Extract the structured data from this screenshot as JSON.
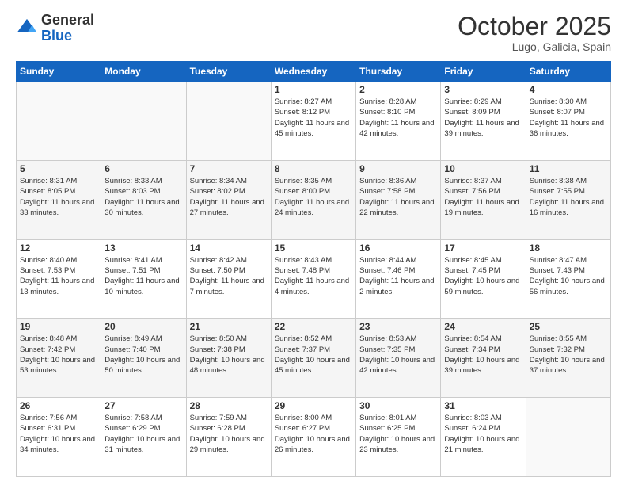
{
  "header": {
    "logo_general": "General",
    "logo_blue": "Blue",
    "month_title": "October 2025",
    "location": "Lugo, Galicia, Spain"
  },
  "calendar": {
    "days_of_week": [
      "Sunday",
      "Monday",
      "Tuesday",
      "Wednesday",
      "Thursday",
      "Friday",
      "Saturday"
    ],
    "weeks": [
      [
        {
          "day": "",
          "info": ""
        },
        {
          "day": "",
          "info": ""
        },
        {
          "day": "",
          "info": ""
        },
        {
          "day": "1",
          "info": "Sunrise: 8:27 AM\nSunset: 8:12 PM\nDaylight: 11 hours and 45 minutes."
        },
        {
          "day": "2",
          "info": "Sunrise: 8:28 AM\nSunset: 8:10 PM\nDaylight: 11 hours and 42 minutes."
        },
        {
          "day": "3",
          "info": "Sunrise: 8:29 AM\nSunset: 8:09 PM\nDaylight: 11 hours and 39 minutes."
        },
        {
          "day": "4",
          "info": "Sunrise: 8:30 AM\nSunset: 8:07 PM\nDaylight: 11 hours and 36 minutes."
        }
      ],
      [
        {
          "day": "5",
          "info": "Sunrise: 8:31 AM\nSunset: 8:05 PM\nDaylight: 11 hours and 33 minutes."
        },
        {
          "day": "6",
          "info": "Sunrise: 8:33 AM\nSunset: 8:03 PM\nDaylight: 11 hours and 30 minutes."
        },
        {
          "day": "7",
          "info": "Sunrise: 8:34 AM\nSunset: 8:02 PM\nDaylight: 11 hours and 27 minutes."
        },
        {
          "day": "8",
          "info": "Sunrise: 8:35 AM\nSunset: 8:00 PM\nDaylight: 11 hours and 24 minutes."
        },
        {
          "day": "9",
          "info": "Sunrise: 8:36 AM\nSunset: 7:58 PM\nDaylight: 11 hours and 22 minutes."
        },
        {
          "day": "10",
          "info": "Sunrise: 8:37 AM\nSunset: 7:56 PM\nDaylight: 11 hours and 19 minutes."
        },
        {
          "day": "11",
          "info": "Sunrise: 8:38 AM\nSunset: 7:55 PM\nDaylight: 11 hours and 16 minutes."
        }
      ],
      [
        {
          "day": "12",
          "info": "Sunrise: 8:40 AM\nSunset: 7:53 PM\nDaylight: 11 hours and 13 minutes."
        },
        {
          "day": "13",
          "info": "Sunrise: 8:41 AM\nSunset: 7:51 PM\nDaylight: 11 hours and 10 minutes."
        },
        {
          "day": "14",
          "info": "Sunrise: 8:42 AM\nSunset: 7:50 PM\nDaylight: 11 hours and 7 minutes."
        },
        {
          "day": "15",
          "info": "Sunrise: 8:43 AM\nSunset: 7:48 PM\nDaylight: 11 hours and 4 minutes."
        },
        {
          "day": "16",
          "info": "Sunrise: 8:44 AM\nSunset: 7:46 PM\nDaylight: 11 hours and 2 minutes."
        },
        {
          "day": "17",
          "info": "Sunrise: 8:45 AM\nSunset: 7:45 PM\nDaylight: 10 hours and 59 minutes."
        },
        {
          "day": "18",
          "info": "Sunrise: 8:47 AM\nSunset: 7:43 PM\nDaylight: 10 hours and 56 minutes."
        }
      ],
      [
        {
          "day": "19",
          "info": "Sunrise: 8:48 AM\nSunset: 7:42 PM\nDaylight: 10 hours and 53 minutes."
        },
        {
          "day": "20",
          "info": "Sunrise: 8:49 AM\nSunset: 7:40 PM\nDaylight: 10 hours and 50 minutes."
        },
        {
          "day": "21",
          "info": "Sunrise: 8:50 AM\nSunset: 7:38 PM\nDaylight: 10 hours and 48 minutes."
        },
        {
          "day": "22",
          "info": "Sunrise: 8:52 AM\nSunset: 7:37 PM\nDaylight: 10 hours and 45 minutes."
        },
        {
          "day": "23",
          "info": "Sunrise: 8:53 AM\nSunset: 7:35 PM\nDaylight: 10 hours and 42 minutes."
        },
        {
          "day": "24",
          "info": "Sunrise: 8:54 AM\nSunset: 7:34 PM\nDaylight: 10 hours and 39 minutes."
        },
        {
          "day": "25",
          "info": "Sunrise: 8:55 AM\nSunset: 7:32 PM\nDaylight: 10 hours and 37 minutes."
        }
      ],
      [
        {
          "day": "26",
          "info": "Sunrise: 7:56 AM\nSunset: 6:31 PM\nDaylight: 10 hours and 34 minutes."
        },
        {
          "day": "27",
          "info": "Sunrise: 7:58 AM\nSunset: 6:29 PM\nDaylight: 10 hours and 31 minutes."
        },
        {
          "day": "28",
          "info": "Sunrise: 7:59 AM\nSunset: 6:28 PM\nDaylight: 10 hours and 29 minutes."
        },
        {
          "day": "29",
          "info": "Sunrise: 8:00 AM\nSunset: 6:27 PM\nDaylight: 10 hours and 26 minutes."
        },
        {
          "day": "30",
          "info": "Sunrise: 8:01 AM\nSunset: 6:25 PM\nDaylight: 10 hours and 23 minutes."
        },
        {
          "day": "31",
          "info": "Sunrise: 8:03 AM\nSunset: 6:24 PM\nDaylight: 10 hours and 21 minutes."
        },
        {
          "day": "",
          "info": ""
        }
      ]
    ]
  }
}
